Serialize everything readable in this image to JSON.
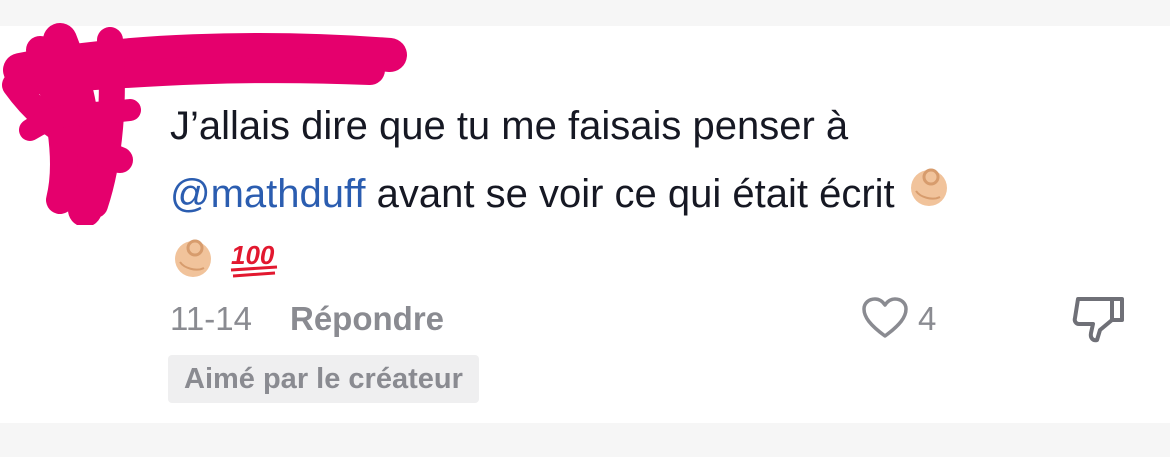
{
  "comment": {
    "text_line1": "J’allais dire que tu me faisais penser à",
    "mention": "@mathduff",
    "text_line2": " avant se voir ce qui était écrit ",
    "emojis": [
      "ok-hand",
      "ok-hand",
      "hundred-points"
    ]
  },
  "meta": {
    "date": "11-14",
    "reply_label": "Répondre",
    "like_count": "4"
  },
  "badge": {
    "label": "Aimé par le créateur"
  },
  "colors": {
    "mention": "#2b5db0",
    "text": "#161823",
    "muted": "#8a8b91",
    "redaction": "#e5006d"
  }
}
